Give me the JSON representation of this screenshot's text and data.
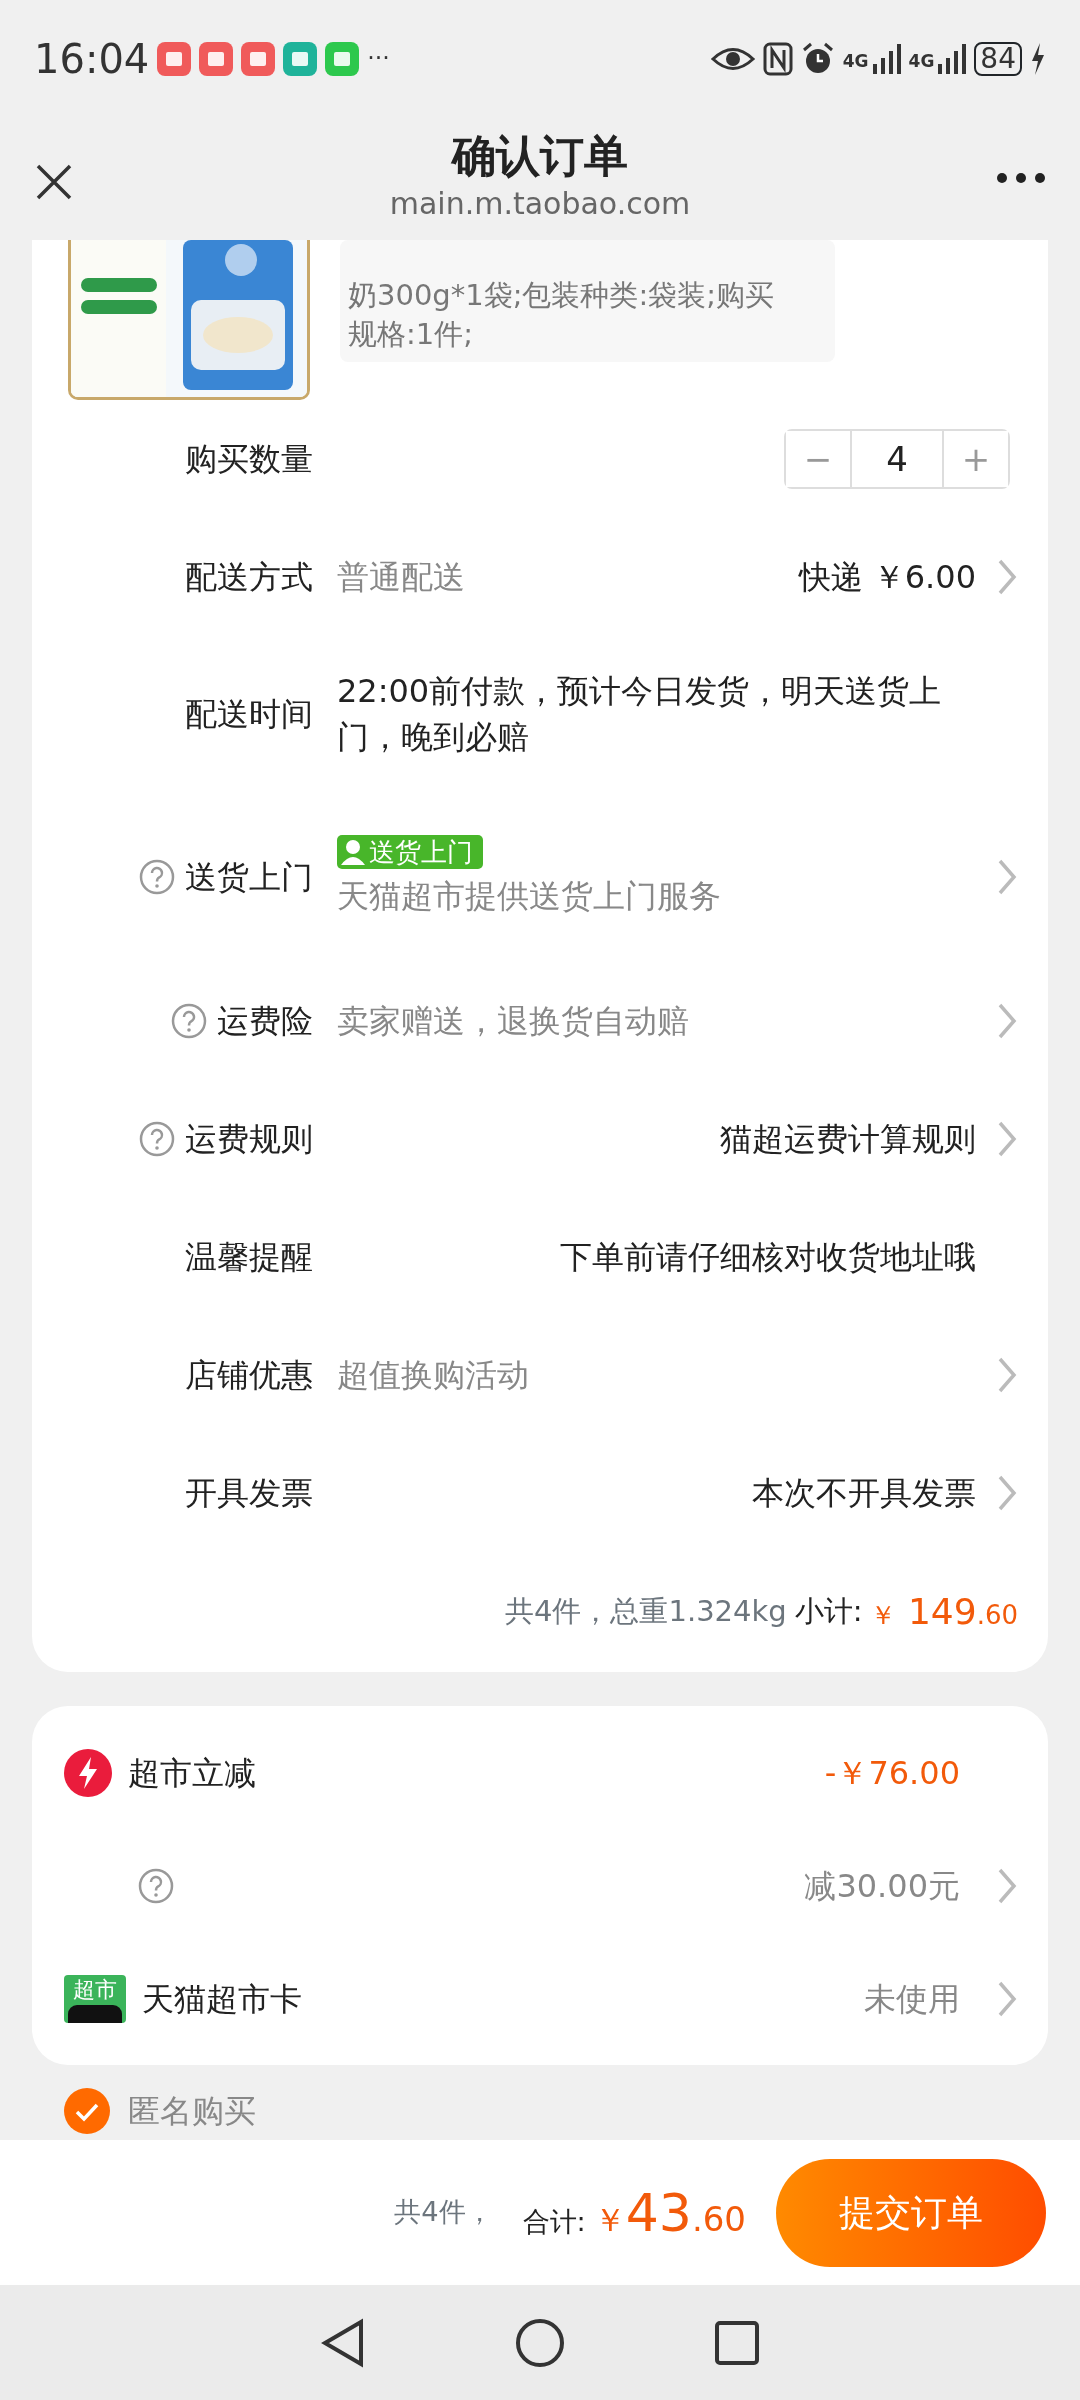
{
  "status_bar": {
    "time": "16:04",
    "more": "···",
    "network_1": "4G",
    "network_2": "4G",
    "battery": "84"
  },
  "header": {
    "title": "确认订单",
    "url": "main.m.taobao.com"
  },
  "product": {
    "kind": "picture",
    "spec_lines": [
      "奶300g*1袋;包装种类:袋装;购买",
      "规格:1件;"
    ]
  },
  "quantity": {
    "label": "购买数量",
    "minus": "−",
    "value": "4",
    "plus": "+"
  },
  "rows": [
    {
      "kind": "plain",
      "label": "配送方式",
      "hint": "普通配送",
      "value": "快递 ￥6.00",
      "help": false,
      "arrow": true
    },
    {
      "kind": "text",
      "label": "配送时间",
      "text": "22:00前付款，预计今日发货，明天送货上门，晚到必赔",
      "help": false,
      "arrow": false
    },
    {
      "kind": "badge",
      "label": "送货上门",
      "badge": "送货上门",
      "hint": "天猫超市提供送货上门服务",
      "help": true,
      "arrow": true
    },
    {
      "kind": "plain",
      "label": "运费险",
      "hint": "卖家赠送，退换货自动赔",
      "help": true,
      "arrow": true
    },
    {
      "kind": "plain",
      "label": "运费规则",
      "value": "猫超运费计算规则",
      "help": true,
      "arrow": true
    },
    {
      "kind": "plain",
      "label": "温馨提醒",
      "value": "下单前请仔细核对收货地址哦",
      "help": false,
      "arrow": false
    },
    {
      "kind": "plain",
      "label": "店铺优惠",
      "hint": "超值换购活动",
      "help": false,
      "arrow": true
    },
    {
      "kind": "plain",
      "label": "开具发票",
      "value": "本次不开具发票",
      "help": false,
      "arrow": true
    }
  ],
  "subtotal": {
    "summary": "共4件，总重1.324kg",
    "label": "小计:",
    "symbol": "￥",
    "integer": " 149",
    "decimal": ".60"
  },
  "discounts": [
    {
      "kind": "flash",
      "label": "超市立减",
      "value": "-￥76.00",
      "arrow": false
    },
    {
      "kind": "help",
      "value": "减30.00元",
      "arrow": true
    },
    {
      "kind": "card",
      "icon_text": "超市",
      "label": "天猫超市卡",
      "value": "未使用",
      "arrow": true
    }
  ],
  "anonymous": {
    "label": "匿名购买",
    "checked": true
  },
  "footer": {
    "count": "共4件，",
    "label": "合计:",
    "symbol": "￥",
    "integer": "43",
    "decimal": ".60",
    "submit": "提交订单"
  }
}
